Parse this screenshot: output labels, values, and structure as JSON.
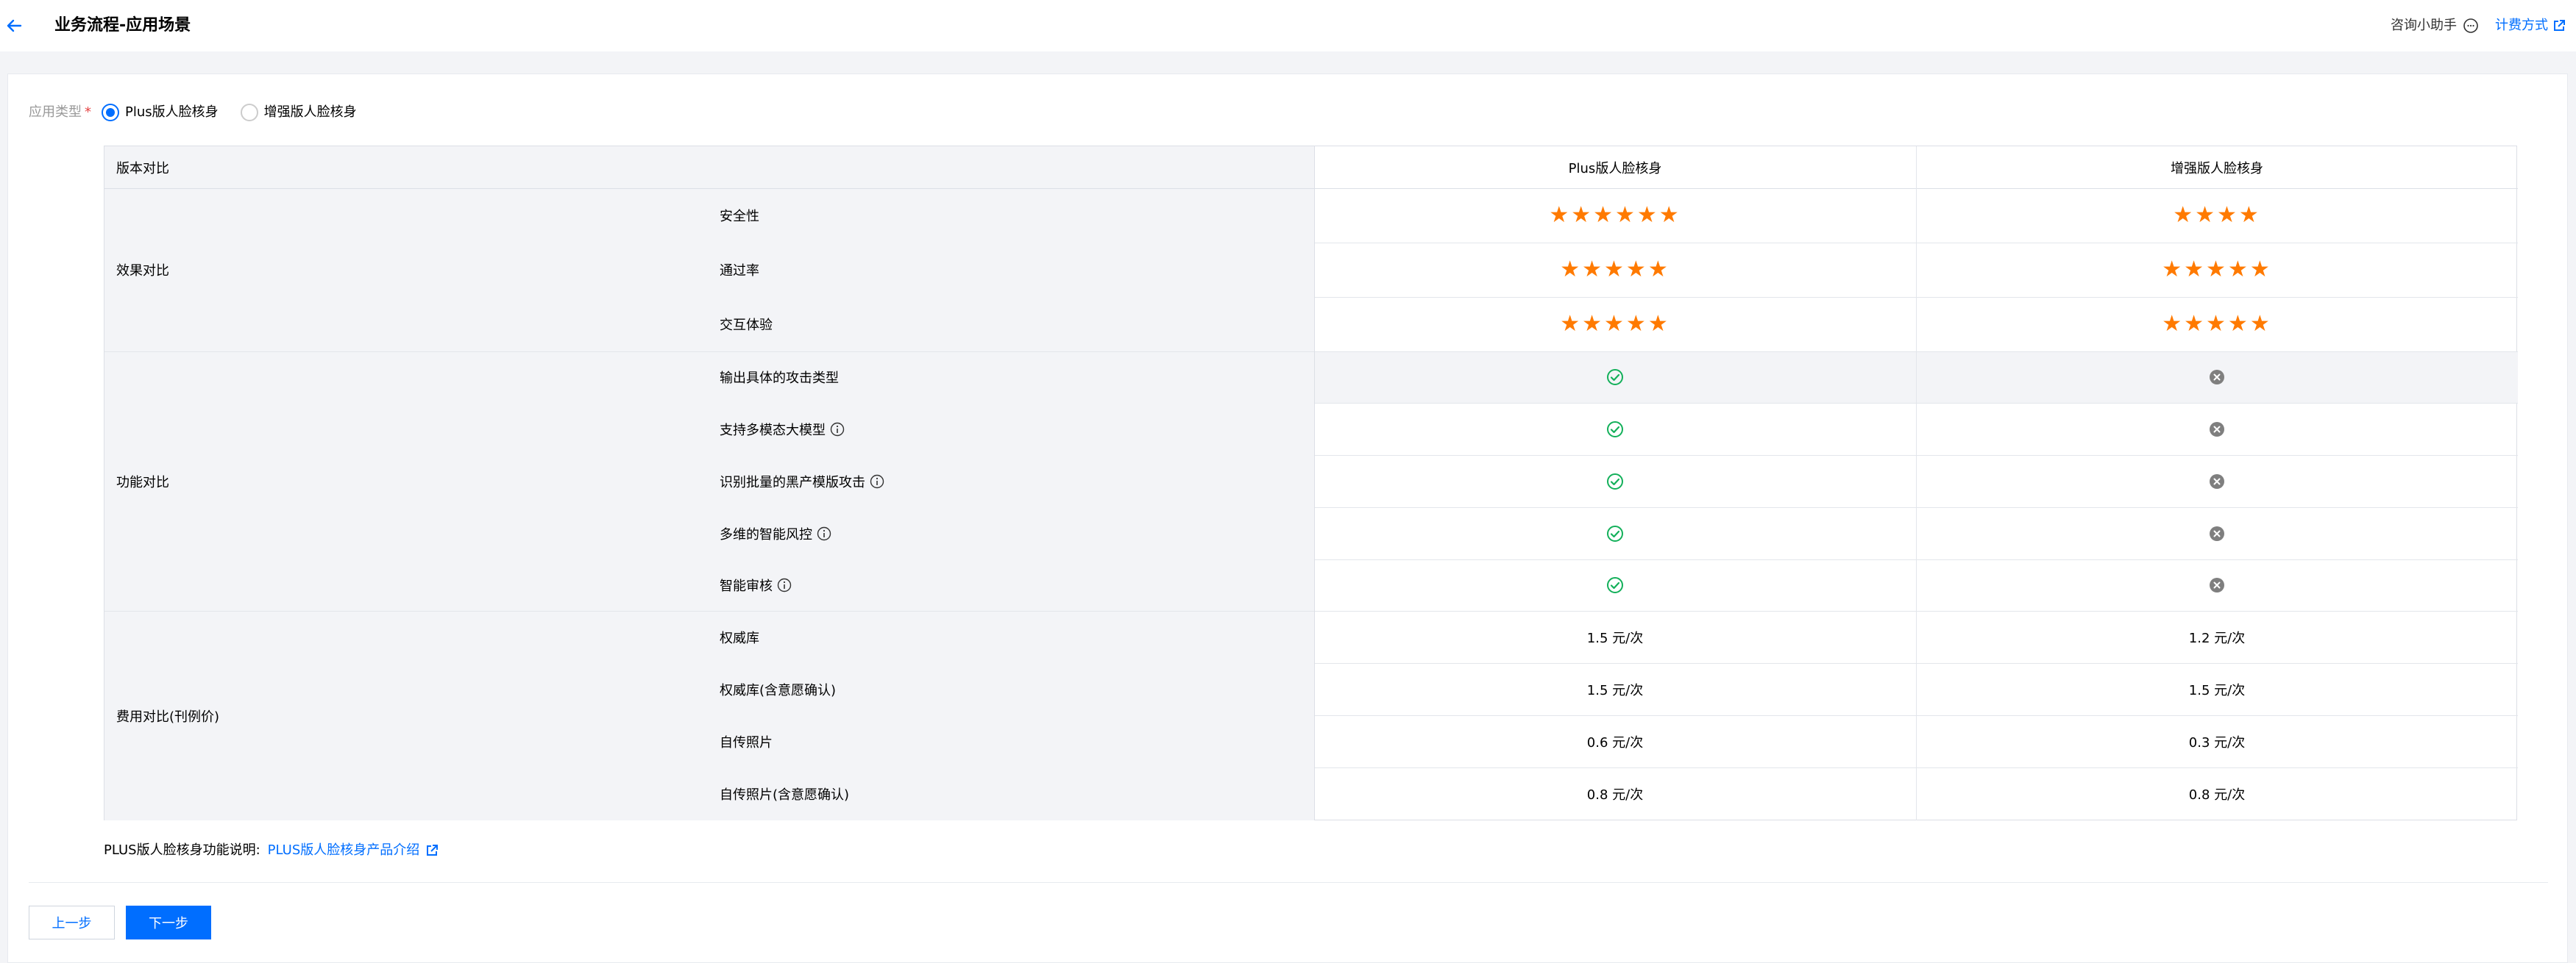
{
  "header": {
    "title": "业务流程-应用场景",
    "assistant": "咨询小助手",
    "billing": "计费方式"
  },
  "apptype": {
    "label": "应用类型",
    "required_mark": "*",
    "options": [
      "Plus版人脸核身",
      "增强版人脸核身"
    ],
    "selected": "Plus版人脸核身"
  },
  "table": {
    "header": [
      "版本对比",
      "Plus版人脸核身",
      "增强版人脸核身"
    ],
    "groups": [
      "效果对比",
      "功能对比",
      "费用对比(刊例价)"
    ],
    "effect_rows": [
      {
        "name": "安全性",
        "plus_stars": 6,
        "plus": "★★★★★★",
        "enhanced_stars": 4,
        "enhanced": "★★★★"
      },
      {
        "name": "通过率",
        "plus_stars": 5,
        "plus": "★★★★★",
        "enhanced_stars": 5,
        "enhanced": "★★★★★"
      },
      {
        "name": "交互体验",
        "plus_stars": 5,
        "plus": "★★★★★",
        "enhanced_stars": 5,
        "enhanced": "★★★★★"
      }
    ],
    "function_rows": [
      {
        "name": "输出具体的攻击类型",
        "info": false,
        "plus": "check-circle-icon",
        "enhanced": "x-circle-icon"
      },
      {
        "name": "支持多模态大模型",
        "info": true,
        "plus": "check-circle-icon",
        "enhanced": "x-circle-icon"
      },
      {
        "name": "识别批量的黑产模版攻击",
        "info": true,
        "plus": "check-circle-icon",
        "enhanced": "x-circle-icon"
      },
      {
        "name": "多维的智能风控",
        "info": true,
        "plus": "check-circle-icon",
        "enhanced": "x-circle-icon"
      },
      {
        "name": "智能审核",
        "info": true,
        "plus": "check-circle-icon",
        "enhanced": "x-circle-icon"
      }
    ],
    "fee_rows": [
      {
        "name": "权威库",
        "plus": "1.5 元/次",
        "enhanced": "1.2 元/次"
      },
      {
        "name": "权威库(含意愿确认)",
        "plus": "1.5 元/次",
        "enhanced": "1.5 元/次"
      },
      {
        "name": "自传照片",
        "plus": "0.6 元/次",
        "enhanced": "0.3 元/次"
      },
      {
        "name": "自传照片(含意愿确认)",
        "plus": "0.8 元/次",
        "enhanced": "0.8 元/次"
      }
    ]
  },
  "description": {
    "label": "PLUS版人脸核身功能说明:",
    "link": "PLUS版人脸核身产品介绍"
  },
  "buttons": {
    "prev": "上一步",
    "next": "下一步"
  },
  "colors": {
    "accent": "#006eff",
    "star": "#ff7a00",
    "check": "#13b05a",
    "cross": "#7f7f7f"
  }
}
